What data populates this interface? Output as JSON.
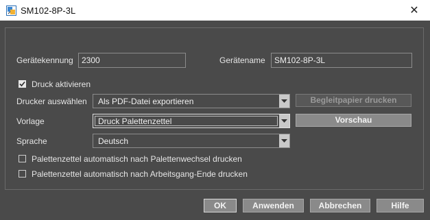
{
  "window": {
    "title": "SM102-8P-3L",
    "icon": "device-settings-icon",
    "close_glyph": "✕"
  },
  "form": {
    "device_id_label": "Gerätekennung",
    "device_id_value": "2300",
    "device_name_label": "Gerätename",
    "device_name_value": "SM102-8P-3L",
    "enable_print_label": "Druck aktivieren",
    "enable_print_checked": true,
    "printer_label": "Drucker auswählen",
    "printer_value": "Als PDF-Datei exportieren",
    "template_label": "Vorlage",
    "template_value": "Druck Palettenzettel",
    "language_label": "Sprache",
    "language_value": "Deutsch",
    "auto_print_pallet_change_label": "Palettenzettel automatisch nach Palettenwechsel drucken",
    "auto_print_pallet_change_checked": false,
    "auto_print_operation_end_label": "Palettenzettel automatisch nach Arbeitsgang-Ende drucken",
    "auto_print_operation_end_checked": false
  },
  "side_buttons": {
    "accompanying_paper": "Begleitpapier drucken",
    "preview": "Vorschau"
  },
  "footer": {
    "ok": "OK",
    "apply": "Anwenden",
    "cancel": "Abbrechen",
    "help": "Hilfe"
  },
  "colors": {
    "background": "#4a4a4a",
    "button": "#8a8a8a",
    "titlebar": "#ffffff"
  }
}
